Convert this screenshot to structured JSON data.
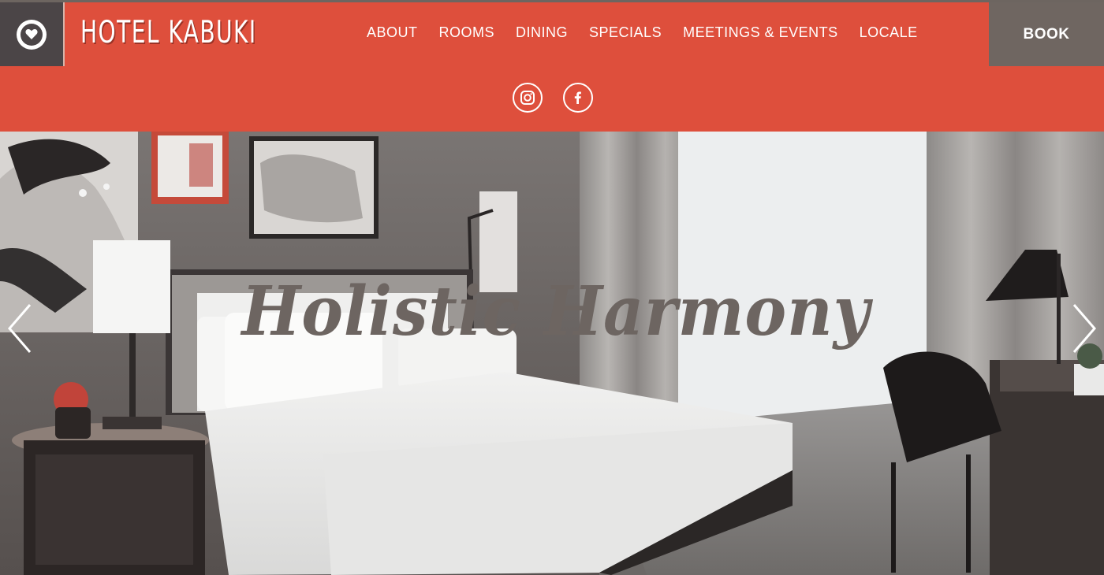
{
  "brand": {
    "name": "HOTEL KABUKI",
    "logo_icon": "heart-circle-icon"
  },
  "nav": {
    "items": [
      {
        "label": "ABOUT"
      },
      {
        "label": "ROOMS"
      },
      {
        "label": "DINING"
      },
      {
        "label": "SPECIALS"
      },
      {
        "label": "MEETINGS & EVENTS"
      },
      {
        "label": "LOCALE"
      }
    ],
    "book_label": "BOOK"
  },
  "social": [
    {
      "icon": "instagram-icon"
    },
    {
      "icon": "facebook-icon"
    }
  ],
  "hero": {
    "headline": "Holistic Harmony",
    "prev_icon": "chevron-left-icon",
    "next_icon": "chevron-right-icon"
  },
  "colors": {
    "brand_red": "#de4f3c",
    "logo_box": "#4b4547",
    "book_box": "#6f6661",
    "headline": "#6d6561"
  }
}
